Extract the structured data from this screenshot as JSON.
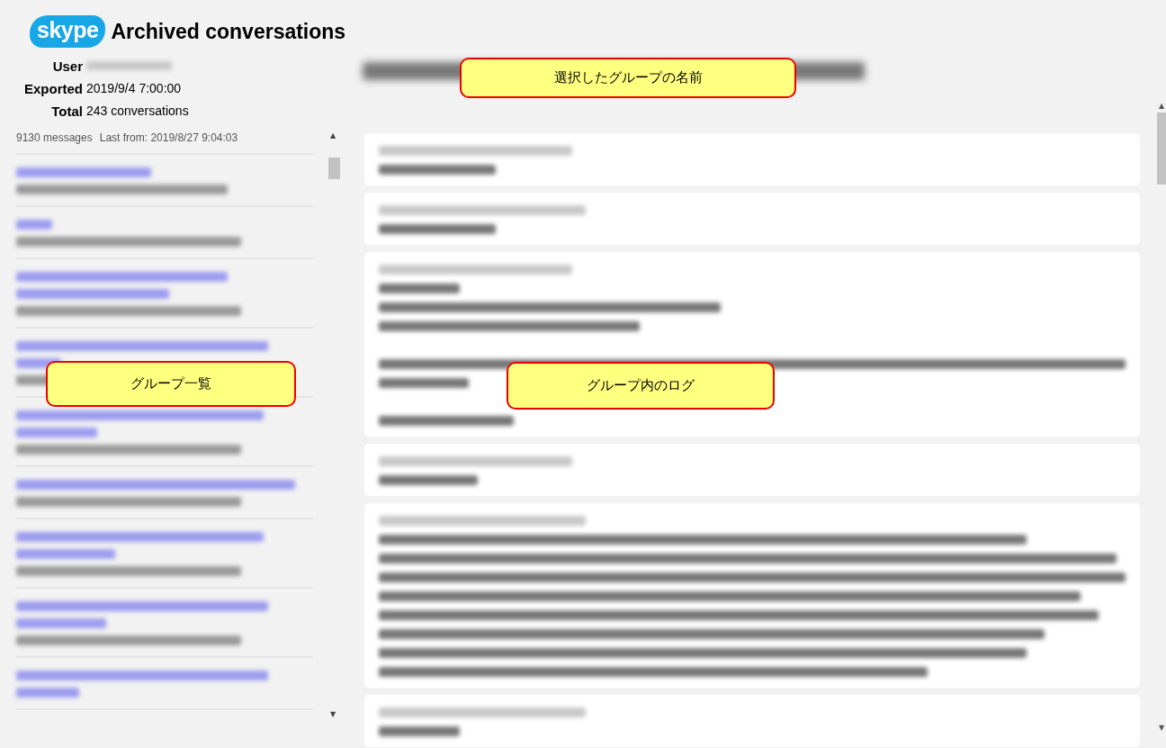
{
  "header": {
    "logo": "skype",
    "title": "Archived conversations"
  },
  "info": [
    {
      "label": "User",
      "value_blurred": true
    },
    {
      "label": "Exported",
      "value": "2019/9/4 7:00:00"
    },
    {
      "label": "Total",
      "value": "243 conversations"
    }
  ],
  "summary": {
    "messages": "9130 messages",
    "last_from": "Last from: 2019/8/27 9:04:03"
  },
  "scroll_arrows": {
    "up": "▲",
    "down": "▼"
  },
  "callouts": [
    {
      "kind": "group-name",
      "text": "選択したグループの名前"
    },
    {
      "kind": "group-list",
      "text": "グループ一覧"
    },
    {
      "kind": "group-log",
      "text": "グループ内のログ"
    }
  ]
}
